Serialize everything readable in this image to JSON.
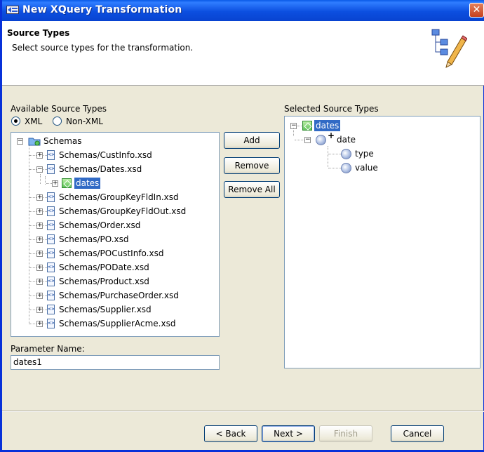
{
  "window": {
    "title": "New XQuery Transformation",
    "close_glyph": "✕"
  },
  "header": {
    "title": "Source Types",
    "description": "Select source types for the transformation."
  },
  "available": {
    "label": "Available Source Types",
    "radio_xml": "XML",
    "radio_nonxml": "Non-XML",
    "selected_radio": "XML",
    "root": "Schemas",
    "items": [
      "Schemas/CustInfo.xsd",
      "Schemas/Dates.xsd",
      "dates",
      "Schemas/GroupKeyFldIn.xsd",
      "Schemas/GroupKeyFldOut.xsd",
      "Schemas/Order.xsd",
      "Schemas/PO.xsd",
      "Schemas/POCustInfo.xsd",
      "Schemas/PODate.xsd",
      "Schemas/Product.xsd",
      "Schemas/PurchaseOrder.xsd",
      "Schemas/Supplier.xsd",
      "Schemas/SupplierAcme.xsd"
    ]
  },
  "actions": {
    "add": "Add",
    "remove": "Remove",
    "remove_all": "Remove All"
  },
  "selected": {
    "label": "Selected Source Types",
    "root": "dates",
    "child": "date",
    "child_marker": "+",
    "leaves": [
      "type",
      "value"
    ]
  },
  "parameter": {
    "label": "Parameter Name:",
    "value": "dates1"
  },
  "footer": {
    "back": "< Back",
    "next": "Next >",
    "finish": "Finish",
    "cancel": "Cancel"
  },
  "icons": {
    "title": "xquery-window-icon",
    "wizard": "wizard-pencil-icon",
    "folder": "schema-folder-icon",
    "xsd": "xsd-file-icon",
    "element": "xml-element-icon",
    "attribute": "attribute-ball-icon"
  },
  "colors": {
    "selection": "#316ac5",
    "titlebar": "#0a5ae8",
    "panel": "#ece9d8"
  }
}
